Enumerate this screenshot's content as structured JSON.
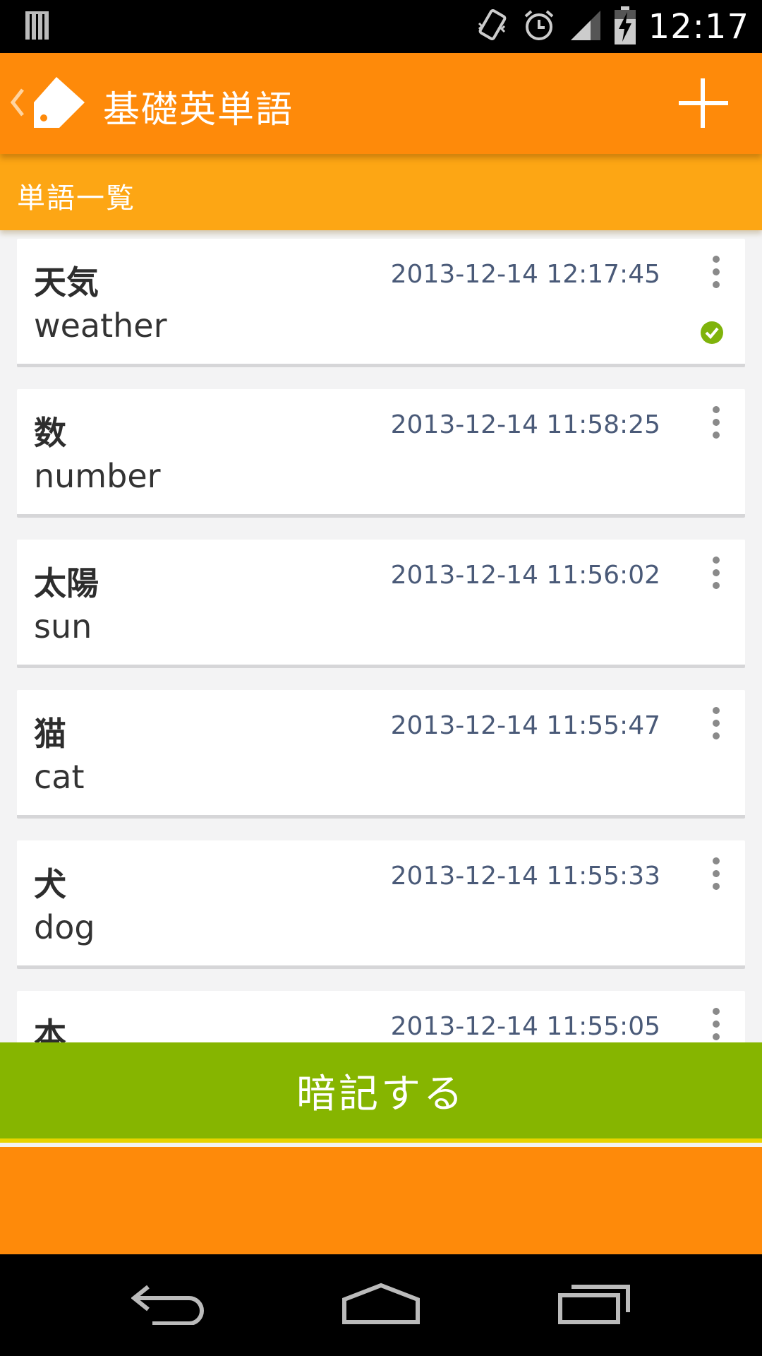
{
  "status_bar": {
    "time": "12:17",
    "icons": [
      "notification-icon",
      "vibrate-icon",
      "alarm-icon",
      "signal-icon",
      "battery-charging-icon"
    ]
  },
  "action_bar": {
    "title": "基礎英単語",
    "up_icon": "chevron-left-icon",
    "logo_icon": "tag-icon",
    "add_icon": "plus-icon"
  },
  "sub_header": {
    "title": "単語一覧"
  },
  "words": [
    {
      "jp": "天気",
      "en": "weather",
      "date": "2013-12-14 12:17:45",
      "checked": true
    },
    {
      "jp": "数",
      "en": "number",
      "date": "2013-12-14 11:58:25",
      "checked": false
    },
    {
      "jp": "太陽",
      "en": "sun",
      "date": "2013-12-14 11:56:02",
      "checked": false
    },
    {
      "jp": "猫",
      "en": "cat",
      "date": "2013-12-14 11:55:47",
      "checked": false
    },
    {
      "jp": "犬",
      "en": "dog",
      "date": "2013-12-14 11:55:33",
      "checked": false
    },
    {
      "jp": "本",
      "en": "",
      "date": "2013-12-14 11:55:05",
      "checked": false
    }
  ],
  "memorize_button": {
    "label": "暗記する"
  },
  "colors": {
    "accent_orange": "#fe8a0a",
    "sub_header_orange": "#fda614",
    "button_green": "#86b500",
    "check_green": "#7fb30b"
  },
  "nav_bar": {
    "icons": [
      "back-icon",
      "home-icon",
      "recents-icon"
    ]
  }
}
